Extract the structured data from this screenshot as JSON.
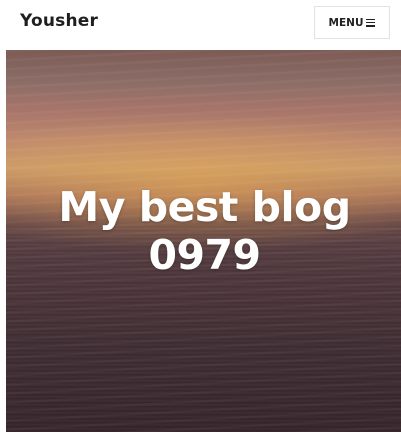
{
  "header": {
    "site_title": "Yousher",
    "menu_label": "MENU"
  },
  "hero": {
    "title_line1": "My best blog",
    "title_line2": "0979"
  },
  "icons": {
    "menu": "hamburger-icon"
  },
  "colors": {
    "header_background": "#ffffff",
    "title_text": "#1f1f1f",
    "hero_text": "#ffffff"
  }
}
